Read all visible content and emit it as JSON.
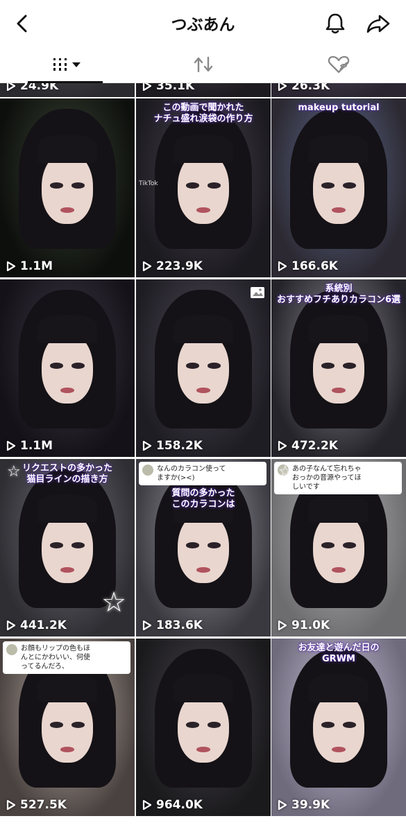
{
  "header": {
    "title": "つぶあん"
  },
  "tabs": [
    {
      "name": "videos-grid",
      "icon": "grid-icon",
      "active": true
    },
    {
      "name": "reposts",
      "icon": "repost-icon",
      "active": false
    },
    {
      "name": "liked-hidden",
      "icon": "heart-hidden-icon",
      "active": false
    }
  ],
  "videos": [
    {
      "views": "24.9K"
    },
    {
      "views": "35.1K"
    },
    {
      "views": "26.3K"
    },
    {
      "views": "1.1M"
    },
    {
      "views": "223.9K",
      "caption": "この動画で聞かれた\nナチュ盛れ涙袋の作り方",
      "watermark": "TikTok"
    },
    {
      "views": "166.6K",
      "caption": "makeup tutorial"
    },
    {
      "views": "1.1M"
    },
    {
      "views": "158.2K"
    },
    {
      "views": "472.2K",
      "caption": "系統別\nおすすめフチありカラコン6選"
    },
    {
      "views": "441.2K",
      "caption": "リクエストの多かった\n猫目ラインの描き方"
    },
    {
      "views": "183.6K",
      "bubble": "なんのカラコン使って\nますか(><)",
      "caption": "質問の多かった\nこのカラコンは"
    },
    {
      "views": "91.0K",
      "bubble": "あの子なんて忘れちゃ\nおっかの音源やってほ\nしいです"
    },
    {
      "views": "527.5K",
      "bubble": "お顔もリップの色もほ\nんとにかわいい、何使\nってるんだろ、"
    },
    {
      "views": "964.0K"
    },
    {
      "views": "39.9K",
      "caption": "お友達と遊んだ日の\nGRWM"
    }
  ],
  "colors": {
    "accent": "#111111",
    "background": "#ffffff"
  }
}
